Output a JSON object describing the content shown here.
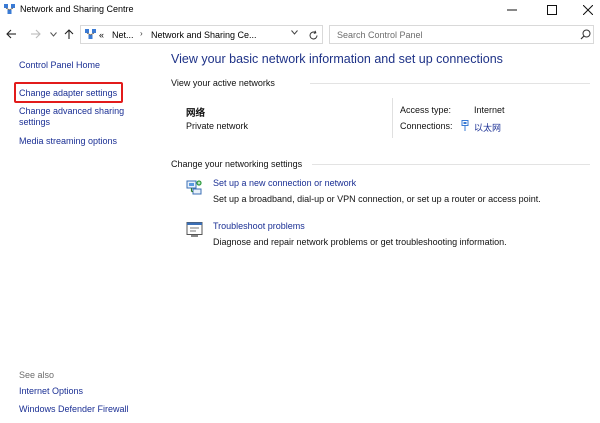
{
  "window": {
    "title": "Network and Sharing Centre"
  },
  "address_bar": {
    "overflow": "«",
    "crumb1": "Net...",
    "crumb2": "Network and Sharing Ce..."
  },
  "search": {
    "placeholder": "Search Control Panel"
  },
  "left_pane": {
    "home": "Control Panel Home",
    "adapter": "Change adapter settings",
    "advanced": "Change advanced sharing settings",
    "media": "Media streaming options",
    "see_also_title": "See also",
    "see_also": [
      "Internet Options",
      "Windows Defender Firewall"
    ]
  },
  "main": {
    "heading": "View your basic network information and set up connections",
    "active_networks_label": "View your active networks",
    "network": {
      "name": "网络",
      "type": "Private network",
      "access_type_label": "Access type:",
      "access_type_value": "Internet",
      "connections_label": "Connections:",
      "connection_name": "以太网"
    },
    "change_settings_label": "Change your networking settings",
    "tasks": [
      {
        "icon": "new-connection-icon",
        "link": "Set up a new connection or network",
        "desc": "Set up a broadband, dial-up or VPN connection, or set up a router or access point."
      },
      {
        "icon": "troubleshoot-icon",
        "link": "Troubleshoot problems",
        "desc": "Diagnose and repair network problems or get troubleshooting information."
      }
    ]
  },
  "colors": {
    "link": "#1a2f94",
    "heading": "#1e3287",
    "highlight": "#e21b1b"
  }
}
